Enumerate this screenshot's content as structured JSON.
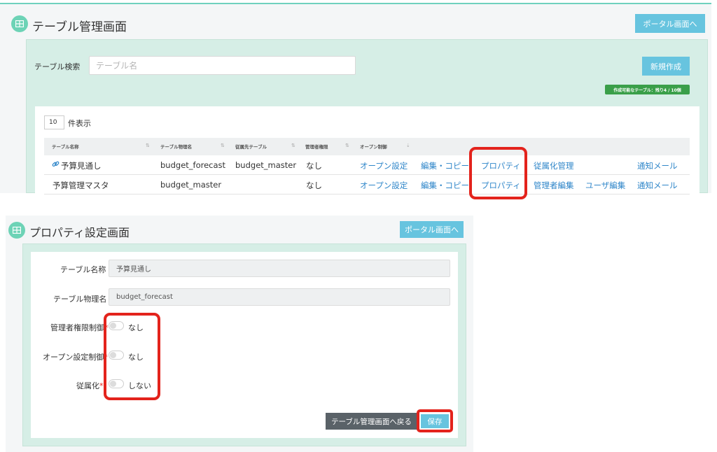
{
  "table_screen": {
    "title": "テーブル管理画面",
    "portal_button": "ポータル画面へ",
    "search": {
      "label": "テーブル検索",
      "placeholder": "テーブル名",
      "value": ""
    },
    "new_button": "新規作成",
    "limit_badge": "作成可能なテーブル：残り4 / 10個",
    "page_size": {
      "value": "10",
      "label": "件表示"
    },
    "columns": [
      "テーブル名称",
      "テーブル物理名",
      "従属先テーブル",
      "管理者権限",
      "オープン制御"
    ],
    "rows": [
      {
        "name": "予算見通し",
        "physical_name": "budget_forecast",
        "parent_table": "budget_master",
        "admin_permission": "なし",
        "actions": [
          "オープン設定",
          "編集・コピー",
          "プロパティ",
          "従属化管理",
          "",
          "通知メール"
        ]
      },
      {
        "name": "予算管理マスタ",
        "physical_name": "budget_master",
        "parent_table": "",
        "admin_permission": "なし",
        "actions": [
          "オープン設定",
          "編集・コピー",
          "プロパティ",
          "管理者編集",
          "ユーザ編集",
          "通知メール"
        ]
      }
    ]
  },
  "property_screen": {
    "title": "プロパティ設定画面",
    "portal_button": "ポータル画面へ",
    "fields": {
      "table_name": {
        "label": "テーブル名称",
        "value": "予算見通し"
      },
      "physical_name": {
        "label": "テーブル物理名",
        "value": "budget_forecast"
      },
      "admin_control": {
        "label": "管理者権限制御",
        "required_mark": "*",
        "value_text": "なし",
        "on": false
      },
      "open_control": {
        "label": "オープン設定制御",
        "required_mark": "*",
        "value_text": "なし",
        "on": false
      },
      "subordinate": {
        "label": "従属化",
        "required_mark": "*",
        "value_text": "しない",
        "on": false
      }
    },
    "back_button": "テーブル管理画面へ戻る",
    "save_button": "保存"
  },
  "icons": {
    "title_icon": "table-grid-icon",
    "link_icon": "link-icon"
  },
  "colors": {
    "accent": "#67c4df",
    "panel": "#d6eee6",
    "highlight": "#e3231c",
    "badge": "#3a9f49",
    "link": "#2f86c9"
  }
}
